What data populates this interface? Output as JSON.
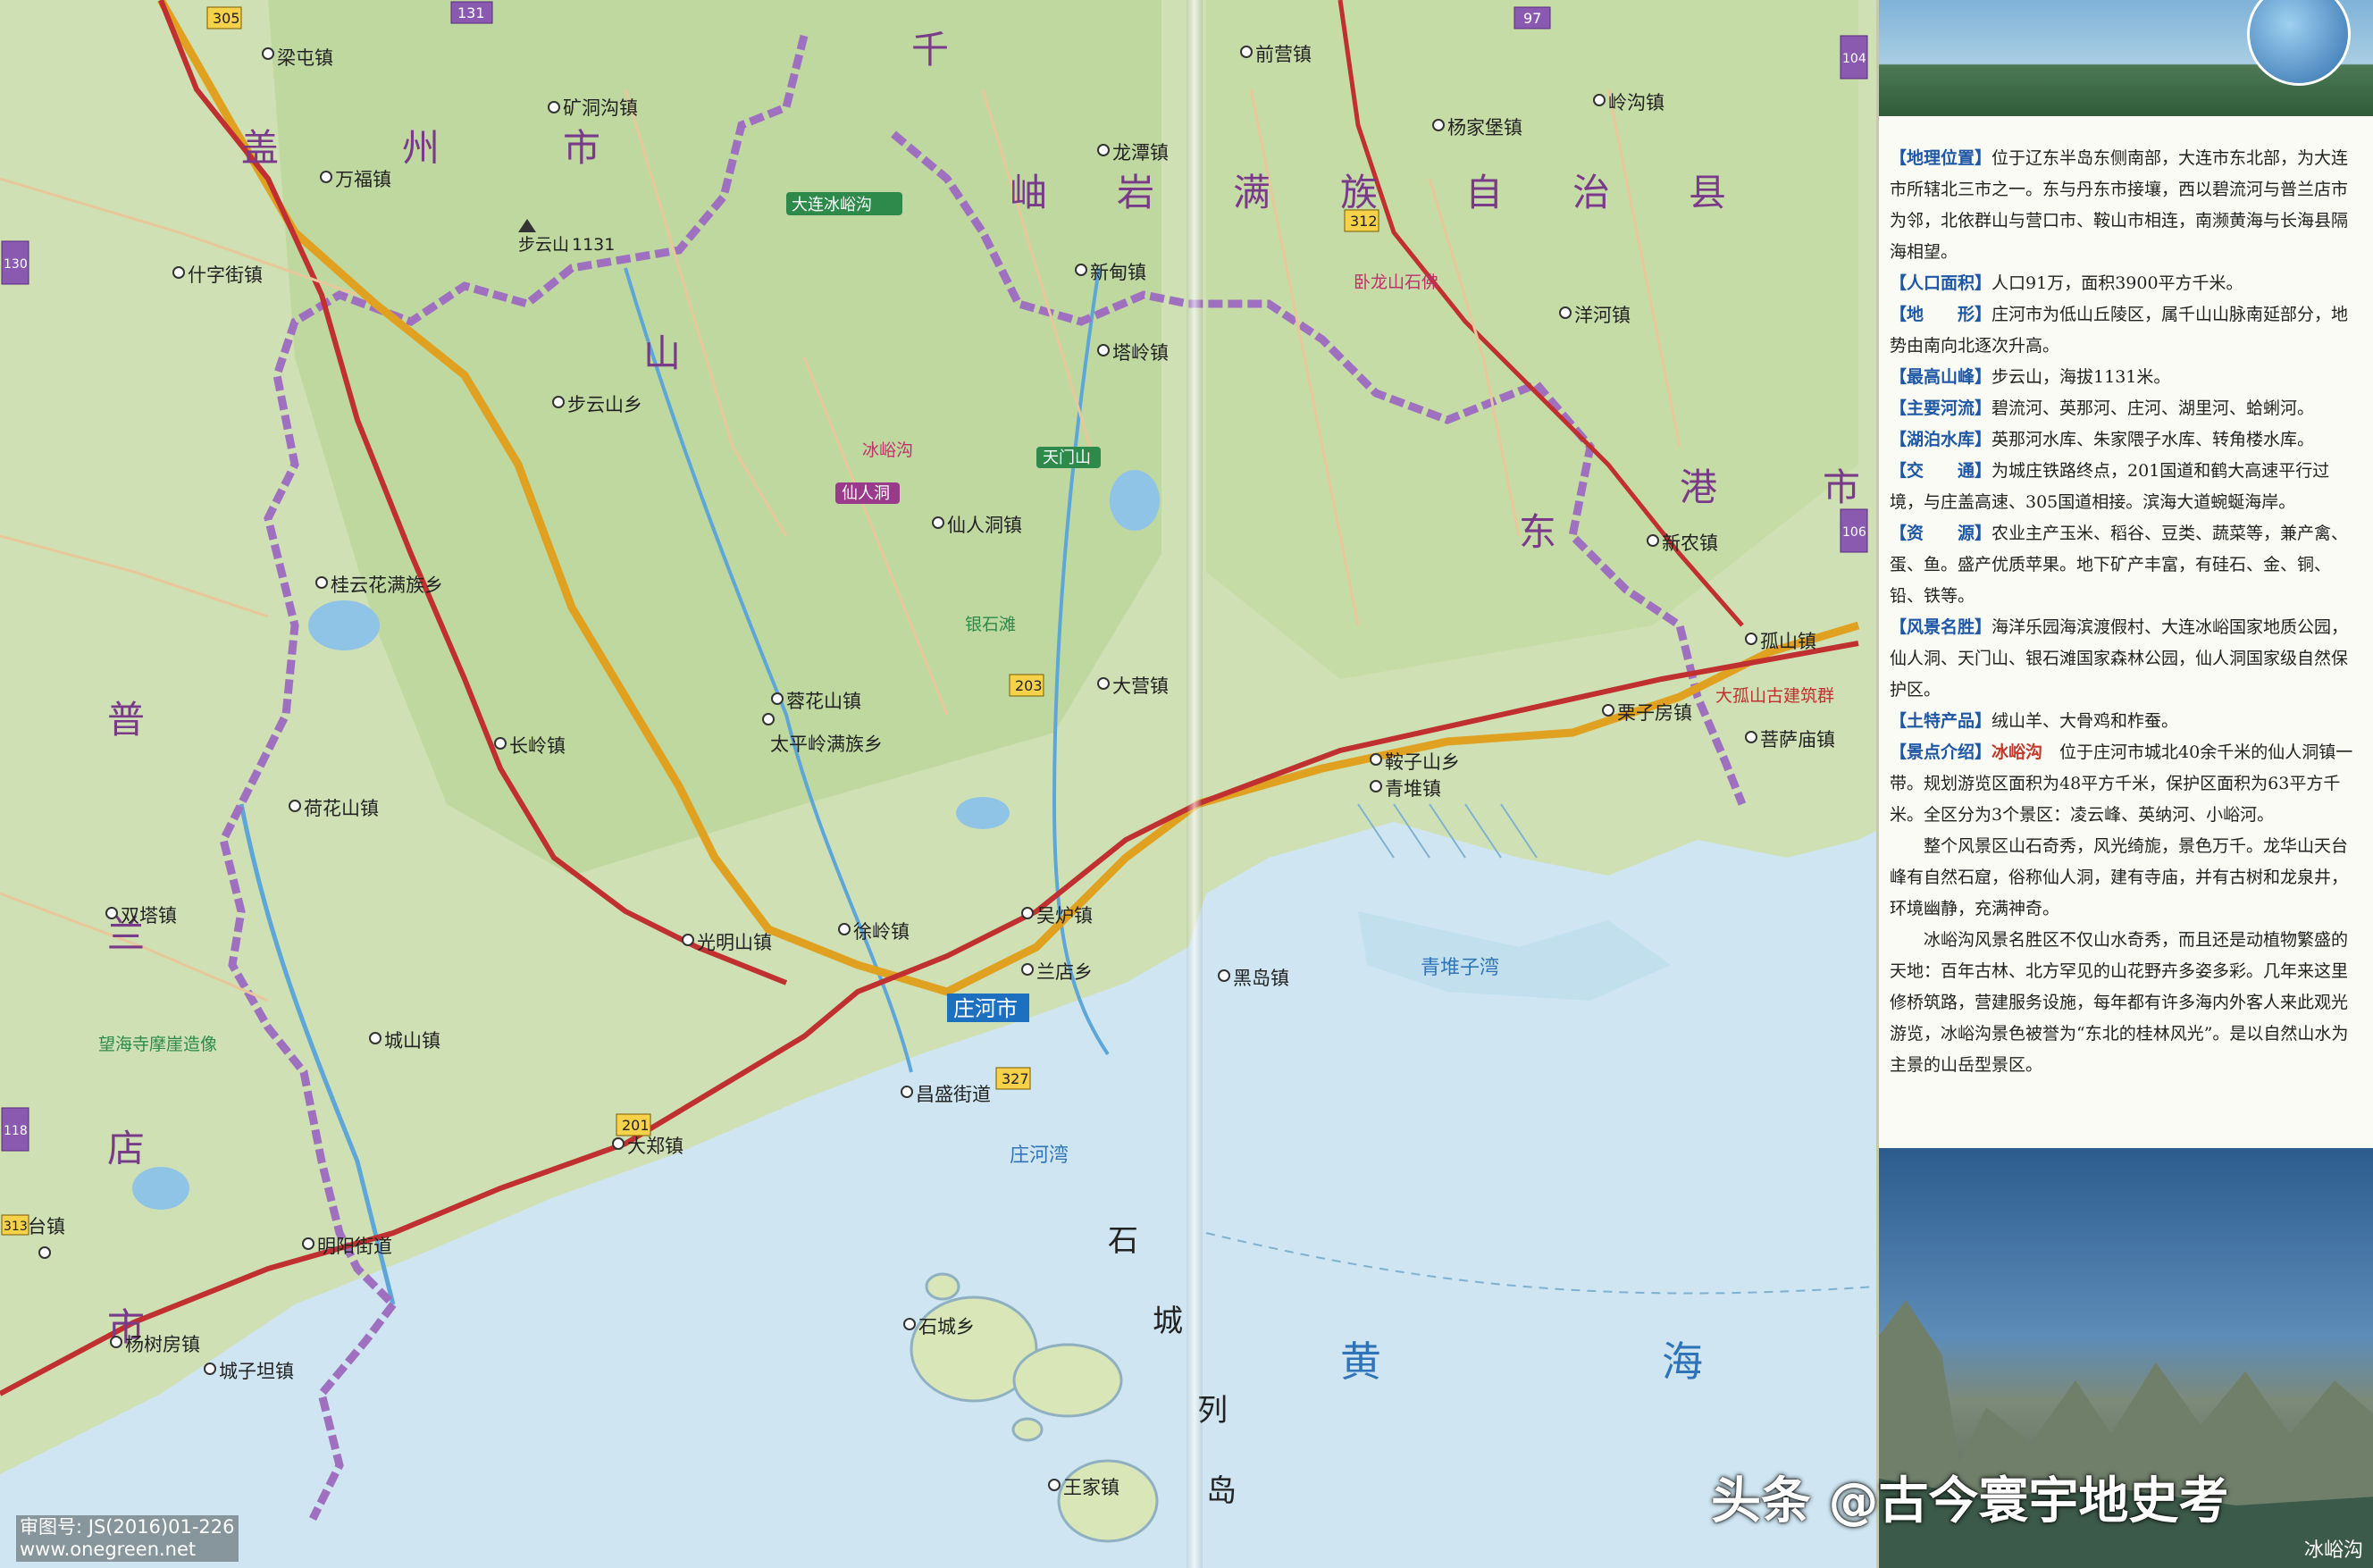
{
  "map": {
    "regions": [
      "盖",
      "州",
      "市",
      "千",
      "山",
      "岫",
      "岩",
      "满",
      "族",
      "自",
      "治",
      "县",
      "东",
      "港",
      "市",
      "普",
      "兰",
      "店",
      "市"
    ],
    "seas": [
      "黄",
      "海",
      "石",
      "城",
      "列",
      "岛"
    ],
    "sea_area": [
      "青堆子湾",
      "庄河湾"
    ],
    "cities": [
      "庄河市"
    ],
    "towns": [
      "梁屯镇",
      "万福镇",
      "矿洞沟镇",
      "什字街镇",
      "步云山乡",
      "桂云花满族乡",
      "长岭镇",
      "荷花山镇",
      "双塔镇",
      "城山镇",
      "明阳街道",
      "大郑镇",
      "光明山镇",
      "徐岭镇",
      "蓉花山镇",
      "仙人洞镇",
      "太平岭满族乡",
      "吴炉镇",
      "兰店乡",
      "昌盛街道",
      "塔岭镇",
      "新甸镇",
      "龙潭镇",
      "前营镇",
      "杨家堡镇",
      "岭沟镇",
      "洋河镇",
      "新农镇",
      "孤山镇",
      "栗子房镇",
      "鞍子山乡",
      "青堆镇",
      "菩萨庙镇",
      "大营镇",
      "黑岛镇",
      "石城乡",
      "王家镇",
      "城子坦镇",
      "杨树房镇",
      "星台镇"
    ],
    "sights": [
      "大连冰峪沟",
      "冰峪沟",
      "仙人洞",
      "天门山",
      "银石滩",
      "望海寺摩崖造像",
      "大孤山古建筑群",
      "卧龙山石佛"
    ],
    "peak": "步云山",
    "peak_height": "1131",
    "road_shields": [
      "305",
      "201",
      "327",
      "203",
      "131",
      "97",
      "312",
      "104",
      "106",
      "118",
      "130",
      "313"
    ]
  },
  "panel": {
    "entries": [
      {
        "key": "【地理位置】",
        "text": "位于辽东半岛东侧南部，大连市东北部，为大连市所辖北三市之一。东与丹东市接壤，西以碧流河与普兰店市为邻，北依群山与营口市、鞍山市相连，南濒黄海与长海县隔海相望。"
      },
      {
        "key": "【人口面积】",
        "text": "人口91万，面积3900平方千米。"
      },
      {
        "key": "【地　　形】",
        "text": "庄河市为低山丘陵区，属千山山脉南延部分，地势由南向北逐次升高。"
      },
      {
        "key": "【最高山峰】",
        "text": "步云山，海拔1131米。"
      },
      {
        "key": "【主要河流】",
        "text": "碧流河、英那河、庄河、湖里河、蛤蜊河。"
      },
      {
        "key": "【湖泊水库】",
        "text": "英那河水库、朱家隈子水库、转角楼水库。"
      },
      {
        "key": "【交　　通】",
        "text": "为城庄铁路终点，201国道和鹤大高速平行过境，与庄盖高速、305国道相接。滨海大道蜿蜒海岸。"
      },
      {
        "key": "【资　　源】",
        "text": "农业主产玉米、稻谷、豆类、蔬菜等，兼产禽、蛋、鱼。盛产优质苹果。地下矿产丰富，有硅石、金、铜、铅、铁等。"
      },
      {
        "key": "【风景名胜】",
        "text": "海洋乐园海滨渡假村、大连冰峪国家地质公园，仙人洞、天门山、银石滩国家森林公园，仙人洞国家级自然保护区。"
      },
      {
        "key": "【土特产品】",
        "text": "绒山羊、大骨鸡和柞蚕。"
      }
    ],
    "intro_key": "【景点介绍】",
    "intro_name": "冰峪沟",
    "intro_text": "位于庄河市城北40余千米的仙人洞镇一带。规划游览区面积为48平方千米，保护区面积为63平方千米。全区分为3个景区：凌云峰、英纳河、小峪河。",
    "paragraphs": [
      "整个风景区山石奇秀，风光绮旎，景色万千。龙华山天台峰有自然石窟，俗称仙人洞，建有寺庙，并有古树和龙泉井，环境幽静，充满神奇。",
      "冰峪沟风景名胜区不仅山水奇秀，而且还是动植物繁盛的天地：百年古林、北方罕见的山花野卉多姿多彩。几年来这里修桥筑路，营建服务设施，每年都有许多海内外客人来此观光游览，冰峪沟景色被誉为“东北的桂林风光”。是以自然山水为主景的山岳型景区。"
    ],
    "photo_caption": "冰峪沟"
  },
  "watermark": "头条 @古今寰宇地史考",
  "credit_line1": "审图号: JS(2016)01-226",
  "credit_line2": "www.onegreen.net",
  "colors": {
    "land": "#cfe0b4",
    "highland": "#bcd49c",
    "sea": "#cfe6f2",
    "boundary": "#a070c0",
    "highway": "#e0a020",
    "road": "#c03030",
    "key_text": "#1d57a5"
  }
}
